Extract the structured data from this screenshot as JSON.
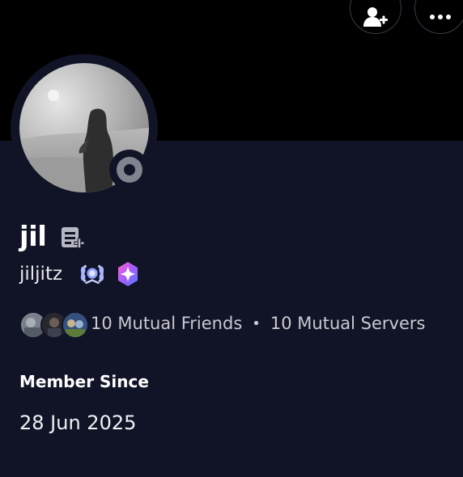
{
  "profile": {
    "display_name": "jil",
    "username": "jiljitz",
    "status": "offline"
  },
  "icons": {
    "add_friend": "add-friend-icon",
    "more": "ellipsis-icon",
    "note": "add-note-icon",
    "badge_1": "laurel-badge-icon",
    "badge_2": "nitro-badge-icon"
  },
  "mutuals": {
    "friends": "10 Mutual Friends",
    "separator": "•",
    "servers": "10 Mutual Servers"
  },
  "member_since": {
    "label": "Member Since",
    "date": "28 Jun 2025"
  },
  "colors": {
    "background": "#111426",
    "banner": "#000000",
    "status_offline": "#80848e"
  }
}
